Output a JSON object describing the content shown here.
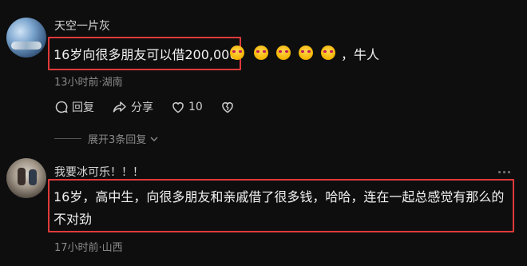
{
  "comments": [
    {
      "username": "天空一片灰",
      "text": "16岁向很多朋友可以借200,000",
      "emojis_count": 5,
      "tail": "，牛人",
      "meta": "13小时前·湖南",
      "actions": {
        "reply": "回复",
        "share": "分享",
        "like_count": "10"
      },
      "expand": "展开3条回复"
    },
    {
      "username": "我要冰可乐！！！",
      "text": "16岁，高中生，向很多朋友和亲戚借了很多钱，哈哈，连在一起总感觉有那么的不对劲",
      "meta": "17小时前·山西"
    }
  ],
  "colors": {
    "highlight_border": "#e03a3a",
    "background": "#0e0e0f"
  },
  "icons": [
    "reply-icon",
    "share-icon",
    "like-icon",
    "dislike-icon",
    "chevron-down-icon",
    "more-icon",
    "emoji-icon"
  ]
}
